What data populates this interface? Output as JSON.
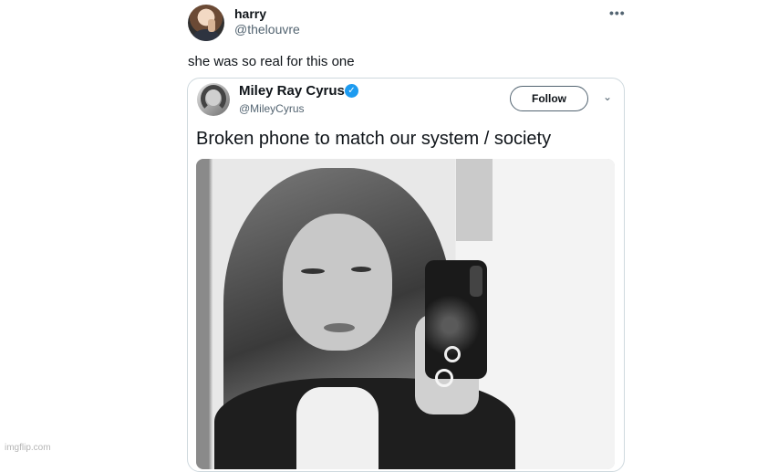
{
  "tweet": {
    "author_name": "harry",
    "author_handle": "@thelouvre",
    "more_icon": "more-horizontal-icon",
    "text": "she was so real for this one"
  },
  "quoted": {
    "author_name": "Miley Ray Cyrus",
    "verified": true,
    "author_handle": "@MileyCyrus",
    "follow_label": "Follow",
    "text": "Broken phone to match our system / society",
    "verified_color": "#1d9bf0"
  },
  "watermark": "imgflip.com"
}
